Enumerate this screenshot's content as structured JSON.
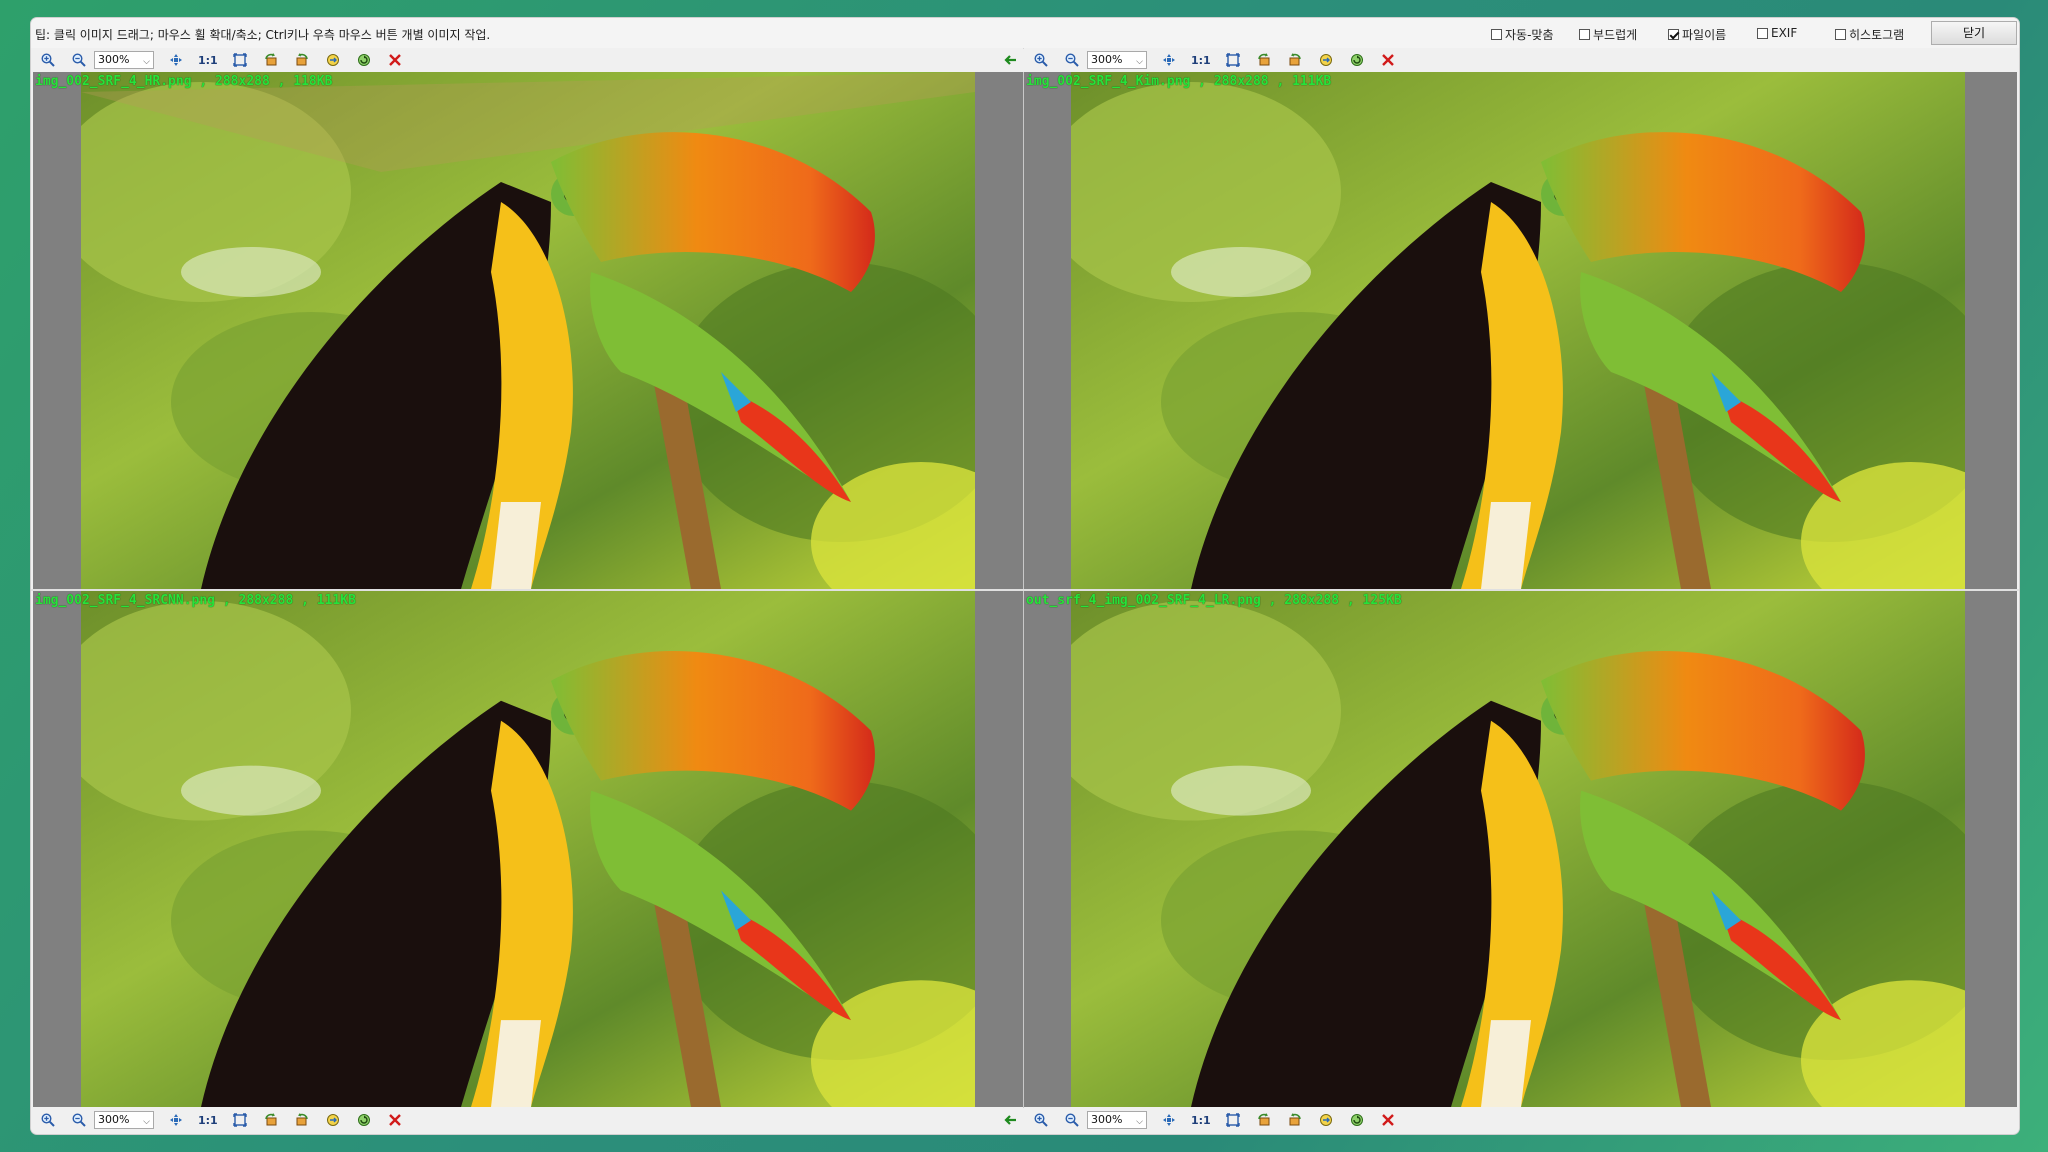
{
  "tipbar": {
    "tip": "팁: 클릭 이미지 드래그; 마우스 휠 확대/축소; Ctrl키나 우측 마우스 버튼 개별 이미지 작업.",
    "options": [
      {
        "label": "자동-맞춤",
        "checked": false
      },
      {
        "label": "부드럽게",
        "checked": false
      },
      {
        "label": "파일이름",
        "checked": true
      },
      {
        "label": "EXIF",
        "checked": false
      },
      {
        "label": "히스토그램",
        "checked": false
      }
    ],
    "close_label": "닫기"
  },
  "toolbar": {
    "zoom_value": "300%",
    "one_to_one_label": "1:1"
  },
  "panels": {
    "top_left": {
      "caption": "img_002_SRF_4_HR.png , 288x288 , 118KB"
    },
    "top_right": {
      "caption": "img_002_SRF_4_Kim.png , 288x288 , 111KB"
    },
    "bottom_left": {
      "caption": "img_002_SRF_4_SRCNN.png , 288x288 , 111KB"
    },
    "bottom_right": {
      "caption": "out_srf_4_img_002_SRF_4_LR.png , 288x288 , 125KB"
    }
  },
  "colors": {
    "caption": "#27e23a",
    "close_icon": "#d11a1a",
    "back_arrow": "#1f8a1f",
    "panel_background": "#808080"
  },
  "icons": [
    "zoom-in-icon",
    "zoom-out-icon",
    "fit-icon",
    "fullscreen-icon",
    "rotate-left-icon",
    "rotate-right-icon",
    "flip-icon",
    "refresh-icon",
    "close-icon",
    "back-arrow-icon"
  ]
}
